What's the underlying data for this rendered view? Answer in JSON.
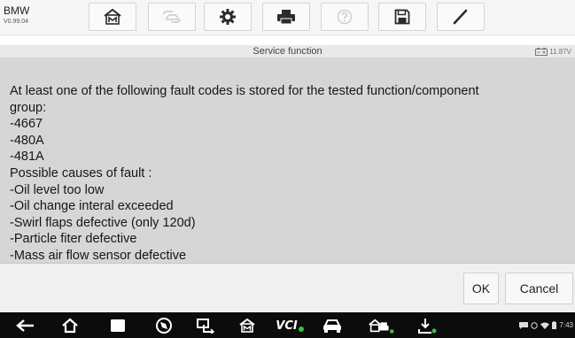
{
  "app": {
    "brand": "BMW",
    "version": "V0.99.04"
  },
  "toolbar": {
    "buttons": [
      {
        "name": "home-button",
        "icon": "home-icon",
        "enabled": true
      },
      {
        "name": "vehicle-swap-button",
        "icon": "car-swap-icon",
        "enabled": false
      },
      {
        "name": "settings-button",
        "icon": "gear-icon",
        "enabled": true
      },
      {
        "name": "print-button",
        "icon": "printer-icon",
        "enabled": true
      },
      {
        "name": "help-button",
        "icon": "help-icon",
        "enabled": false
      },
      {
        "name": "save-button",
        "icon": "floppy-icon",
        "enabled": true
      },
      {
        "name": "edit-button",
        "icon": "pen-icon",
        "enabled": true
      }
    ]
  },
  "titlebar": {
    "title": "Service function",
    "battery_voltage": "11.87V",
    "battery_icon": "battery-icon"
  },
  "message": {
    "lines": [
      "At least one of the following fault codes is stored for the tested function/component",
      "group:",
      "-4667",
      "-480A",
      "-481A",
      "Possible causes of fault :",
      "-Oil level too low",
      "-Oil change interal exceeded",
      "-Swirl flaps defective (only 120d)",
      "-Particle fiter defective",
      "-Mass air flow sensor defective"
    ]
  },
  "footer": {
    "ok_label": "OK",
    "cancel_label": "Cancel"
  },
  "navbar": {
    "vci_label": "VCI",
    "time": "7:43",
    "icons": [
      "back-icon",
      "home-icon",
      "recent-apps-icon",
      "browser-icon",
      "screen-capture-icon",
      "autel-home-icon",
      "vci-icon",
      "vehicle-icon",
      "shop-icon",
      "update-icon"
    ]
  },
  "colors": {
    "content_bg": "#d6d6d6",
    "toolbar_bg": "#f6f6f6",
    "navbar_bg": "#0c0c0c",
    "vci_status_green": "#3dbf3d"
  }
}
